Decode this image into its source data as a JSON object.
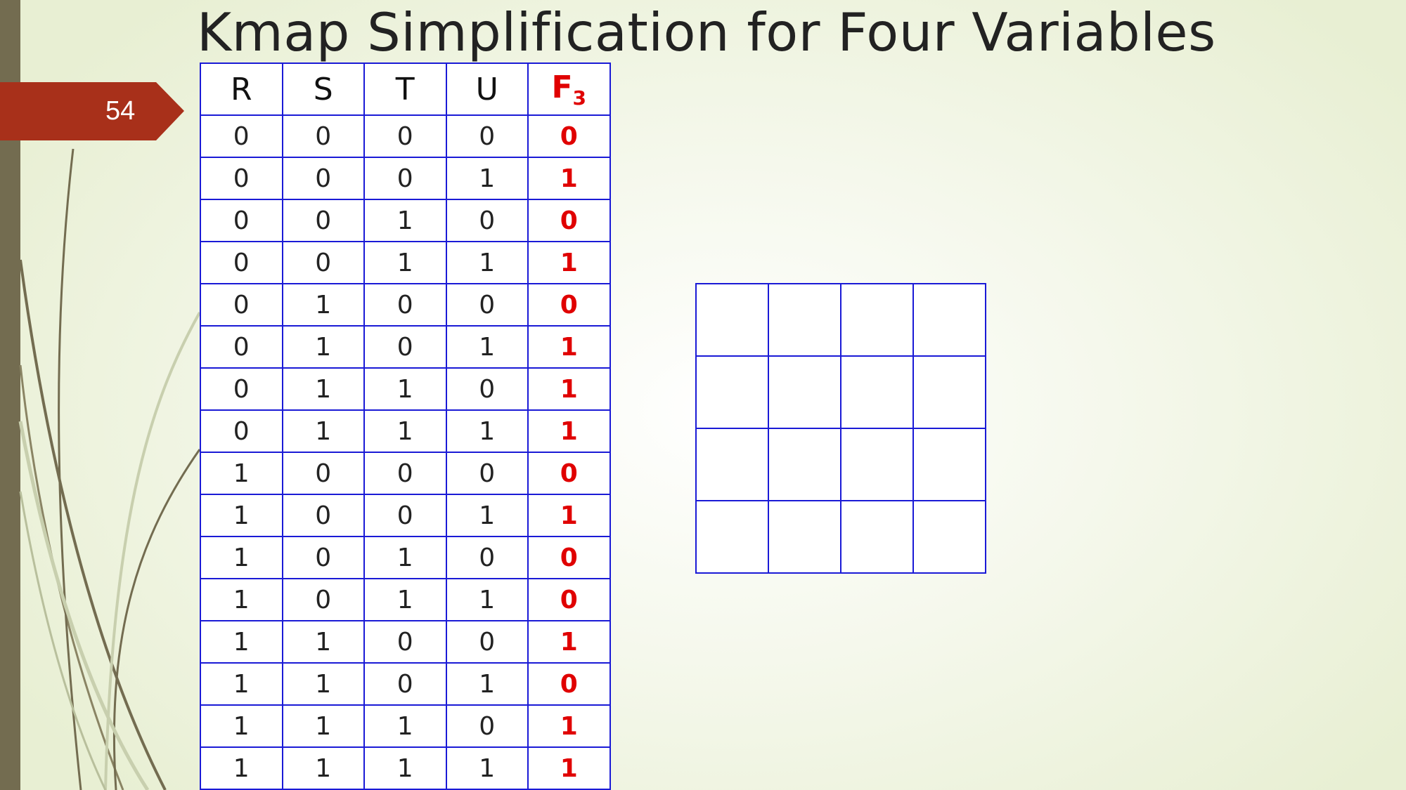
{
  "slide": {
    "title": "Kmap Simplification for Four Variables",
    "number": "54"
  },
  "truth_table": {
    "headers": [
      "R",
      "S",
      "T",
      "U"
    ],
    "output_header": {
      "base": "F",
      "subscript": "3"
    },
    "rows": [
      [
        "0",
        "0",
        "0",
        "0",
        "0"
      ],
      [
        "0",
        "0",
        "0",
        "1",
        "1"
      ],
      [
        "0",
        "0",
        "1",
        "0",
        "0"
      ],
      [
        "0",
        "0",
        "1",
        "1",
        "1"
      ],
      [
        "0",
        "1",
        "0",
        "0",
        "0"
      ],
      [
        "0",
        "1",
        "0",
        "1",
        "1"
      ],
      [
        "0",
        "1",
        "1",
        "0",
        "1"
      ],
      [
        "0",
        "1",
        "1",
        "1",
        "1"
      ],
      [
        "1",
        "0",
        "0",
        "0",
        "0"
      ],
      [
        "1",
        "0",
        "0",
        "1",
        "1"
      ],
      [
        "1",
        "0",
        "1",
        "0",
        "0"
      ],
      [
        "1",
        "0",
        "1",
        "1",
        "0"
      ],
      [
        "1",
        "1",
        "0",
        "0",
        "1"
      ],
      [
        "1",
        "1",
        "0",
        "1",
        "0"
      ],
      [
        "1",
        "1",
        "1",
        "0",
        "1"
      ],
      [
        "1",
        "1",
        "1",
        "1",
        "1"
      ]
    ]
  },
  "kmap": {
    "cells": [
      [
        "",
        "",
        "",
        ""
      ],
      [
        "",
        "",
        "",
        ""
      ],
      [
        "",
        "",
        "",
        ""
      ],
      [
        "",
        "",
        "",
        ""
      ]
    ]
  },
  "colors": {
    "accent_red": "#e00000",
    "grid_blue": "#1a1ad6",
    "tag_red": "#a8301a",
    "sidebar_olive": "#736c50"
  }
}
